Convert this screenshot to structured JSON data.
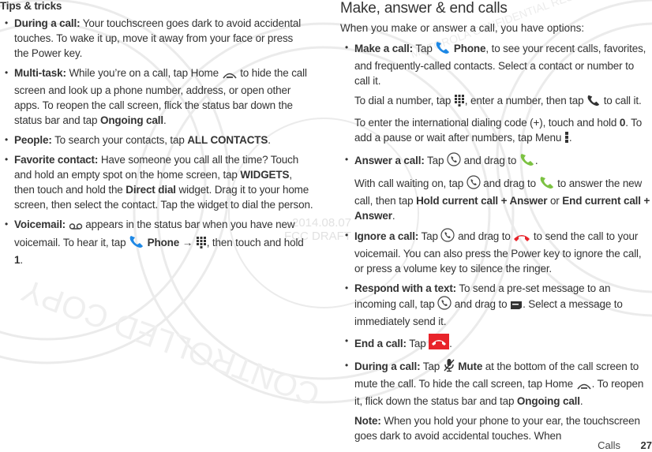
{
  "left_column": {
    "heading": "Tips & tricks",
    "items": [
      {
        "title": "During a call:",
        "text": " Your touchscreen goes dark to avoid accidental touches. To wake it up, move it away from your face or press the Power key."
      },
      {
        "title": "Multi-task:",
        "text_before_icon": " While you’re on a call, tap Home ",
        "icon": "home-icon",
        "text_after_icon": " to hide the call screen and look up a phone number, address, or open other apps. To reopen the call screen, flick the status bar down the status bar and tap ",
        "bold_end": "Ongoing call",
        "end": "."
      },
      {
        "title": "People:",
        "text": " To search your contacts, tap ",
        "bold_end": "ALL CONTACTS",
        "end": "."
      },
      {
        "title": "Favorite contact:",
        "text1": " Have someone you call all the time? Touch and hold an empty spot on the home screen, tap ",
        "bold1": "WIDGETS",
        "text2": ", then touch and hold the ",
        "bold2": "Direct dial",
        "text3": "  widget. Drag it to your home screen, then select the contact. Tap the widget to dial the person."
      },
      {
        "title": "Voicemail:",
        "icon1": "voicemail-icon",
        "text1": " appears in the status bar when you have new voicemail. To hear it, tap ",
        "icon2": "phone-icon",
        "bold1": " Phone",
        "arrow": " → ",
        "icon3": "dialpad-icon",
        "text2": ", then touch and hold ",
        "bold2": "1",
        "end": "."
      }
    ]
  },
  "right_column": {
    "heading": "Make, answer & end calls",
    "intro": "When you make or answer a call, you have options:",
    "make_call": {
      "title": "Make a call:",
      "t1": " Tap ",
      "bold1": " Phone",
      "t2": ", to see your recent calls, favorites, and frequently-called contacts. Select a contact or number to call it.",
      "p2_t1": "To dial a number, tap ",
      "p2_t2": ", enter a number, then tap ",
      "p2_t3": " to call it.",
      "p3_t1": "To enter the international dialing code (+), touch and hold ",
      "p3_b1": "0",
      "p3_t2": ". To add a pause or wait after numbers, tap Menu ",
      "p3_t3": "."
    },
    "answer_call": {
      "title": "Answer a call:",
      "t1": " Tap ",
      "t2": " and drag to ",
      "t3": ".",
      "p2_t1": "With call waiting on, tap ",
      "p2_t2": " and drag to ",
      "p2_t3": " to answer the new call, then tap ",
      "p2_b1": "Hold current call + Answer",
      "p2_t4": " or ",
      "p2_b2": "End current call + Answer",
      "p2_t5": "."
    },
    "ignore_call": {
      "title": "Ignore a call:",
      "t1": " Tap ",
      "t2": " and drag to ",
      "t3": " to send the call to your voicemail. You can also press the Power key to ignore the call, or press a volume key to silence the ringer."
    },
    "respond_text": {
      "title": "Respond with a text:",
      "t1": " To send a pre-set message to an incoming call, tap ",
      "t2": " and drag to ",
      "t3": ". Select a message to immediately send it."
    },
    "end_call": {
      "title": "End a call:",
      "t1": " Tap ",
      "t2": "."
    },
    "during_call": {
      "title": "During a call:",
      "t1": " Tap ",
      "b1": " Mute",
      "t2": " at the bottom of the call screen to mute the call. To hide the call screen, tap Home ",
      "t3": ". To reopen it, flick down the status bar and tap ",
      "b2": "Ongoing call",
      "t4": ".",
      "note_b": "Note:",
      "note_t": " When you hold your phone to your ear, the touchscreen goes dark to avoid accidental touches. When"
    }
  },
  "footer": {
    "section": "Calls",
    "page_number": "27"
  },
  "watermark": {
    "date": "2014.08.07",
    "draft": "FCC DRAFT",
    "stamp_text": "MOTOROLA CONFIDENTIAL RESTRICTED",
    "controlled": "CONTROLLED COPY"
  },
  "colors": {
    "phone_blue": "#1e88e5",
    "answer_green": "#7cc242",
    "ignore_red": "#e8232a",
    "end_red": "#e8232a",
    "text": "#333333",
    "watermark": "#e6e6e6"
  }
}
